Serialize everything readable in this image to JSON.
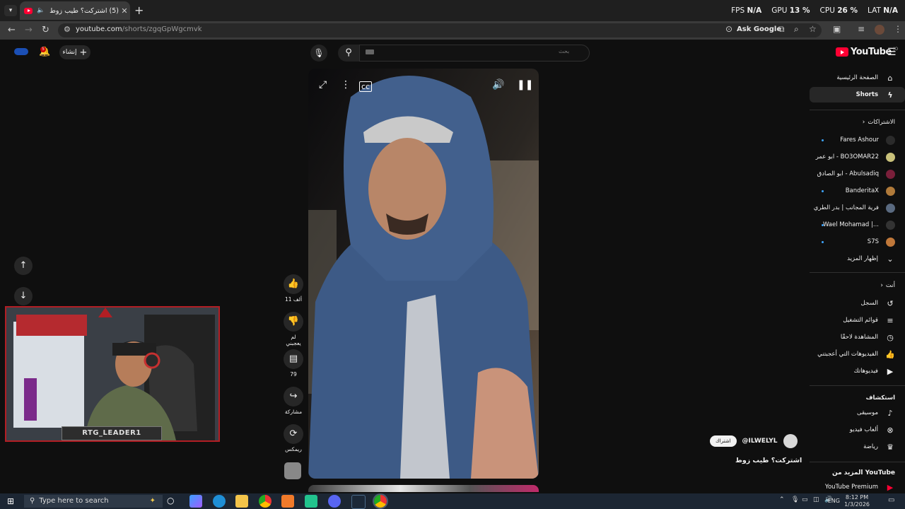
{
  "browser": {
    "tab_title": "(5) اشتركت؟ طيب زوط - YouTube",
    "new_tab": "+",
    "close_tab": "✕",
    "url_host": "youtube.com",
    "url_path": "/shorts/zgqGpWgcmvk",
    "ask_google": "Ask Google"
  },
  "overlay": {
    "fps_label": "FPS",
    "fps_value": "N/A",
    "gpu_label": "GPU",
    "gpu_value": "13 %",
    "cpu_label": "CPU",
    "cpu_value": "26 %",
    "lat_label": "LAT",
    "lat_value": "N/A"
  },
  "header": {
    "logo_text": "YouTube",
    "logo_region": "JO",
    "search_placeholder": "بحث",
    "create_label": "إنشاء",
    "notification_count": "5"
  },
  "sidebar": {
    "home": "الصفحة الرئيسية",
    "shorts": "Shorts",
    "subscriptions_title": "الاشتراكات",
    "subscriptions": [
      {
        "name": "Fares Ashour",
        "color": "#2b2b2b"
      },
      {
        "name": "ابو عمر - BO3OMAR22",
        "color": "#c9c17a"
      },
      {
        "name": "ابو الصادق - Abulsadiq",
        "color": "#7a1f3a"
      },
      {
        "name": "BanderitaX",
        "color": "#b07a3a"
      },
      {
        "name": "فرية المجانب | بدر الطري",
        "color": "#5a6a80"
      },
      {
        "name": "Wael Mohamad |...",
        "color": "#333333"
      },
      {
        "name": "S7S",
        "color": "#c0783a"
      }
    ],
    "show_more": "إظهار المزيد",
    "you_title": "أنت",
    "you_items": [
      "السجل",
      "قوائم التشغيل",
      "المشاهدة لاحقًا",
      "الفيديوهات التي أعجبتني",
      "فيديوهاتك"
    ],
    "explore_title": "استكشاف",
    "explore_items": [
      "موسيقى",
      "ألعاب فيديو",
      "رياضة"
    ],
    "more_title": "المزيد من YouTube",
    "premium": "YouTube Premium"
  },
  "actions": {
    "likes": "11 ألف",
    "dislike": "لم يعجبني",
    "comments": "79",
    "share": "مشاركة",
    "remix": "ريمكس"
  },
  "channel": {
    "handle": "@ILWELYL",
    "subscribe": "اشتراك",
    "video_title": "اشتركت؟ طيب زوط"
  },
  "webcam": {
    "label": "RTG_LEADER1"
  },
  "taskbar": {
    "search_placeholder": "Type here to search",
    "language": "ENG",
    "time": "8:12 PM",
    "date": "1/3/2026"
  }
}
